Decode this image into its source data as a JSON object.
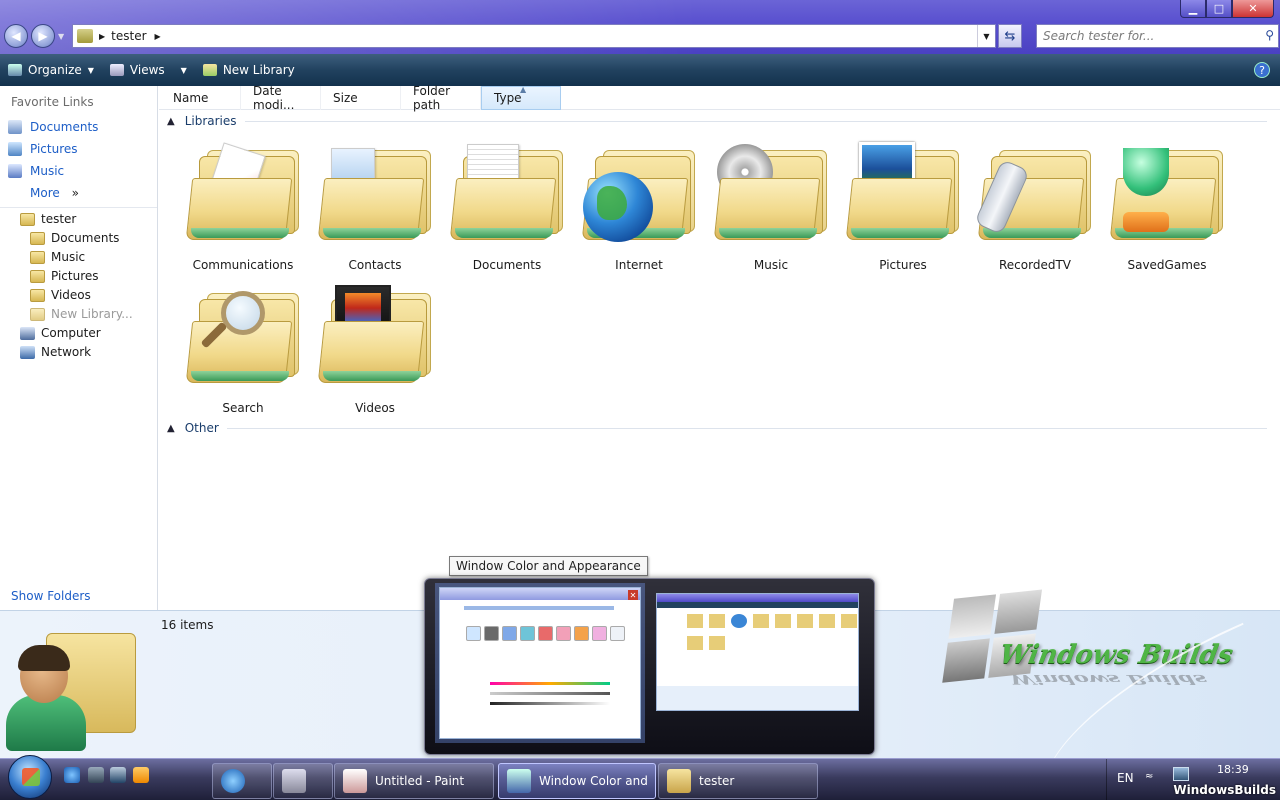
{
  "window": {
    "address": {
      "path_segments": [
        "tester"
      ]
    },
    "search_placeholder": "Search tester for...",
    "buttons": {
      "minimize": "▁",
      "maximize": "□",
      "close": "✕"
    }
  },
  "toolbar": {
    "organize": "Organize",
    "views": "Views",
    "new_library": "New Library",
    "help": "?"
  },
  "navpane": {
    "favorite_links_header": "Favorite Links",
    "favorites": [
      {
        "label": "Documents",
        "icon": "documents-icon"
      },
      {
        "label": "Pictures",
        "icon": "pictures-icon"
      },
      {
        "label": "Music",
        "icon": "music-icon"
      }
    ],
    "more": "More",
    "tree": [
      {
        "label": "tester",
        "icon": "user-folder-icon"
      },
      {
        "label": "Documents",
        "icon": "folder-icon"
      },
      {
        "label": "Music",
        "icon": "folder-icon"
      },
      {
        "label": "Pictures",
        "icon": "folder-icon"
      },
      {
        "label": "Videos",
        "icon": "folder-icon"
      },
      {
        "label": "New Library...",
        "icon": "new-library-icon"
      },
      {
        "label": "Computer",
        "icon": "computer-icon"
      },
      {
        "label": "Network",
        "icon": "network-icon"
      }
    ],
    "show_folders": "Show Folders"
  },
  "columns": [
    "Name",
    "Date modi...",
    "Size",
    "Folder path",
    "Type"
  ],
  "groups": {
    "libraries": "Libraries",
    "other": "Other"
  },
  "libraries": [
    {
      "label": "Communications",
      "icon": "communications-library-icon"
    },
    {
      "label": "Contacts",
      "icon": "contacts-library-icon"
    },
    {
      "label": "Documents",
      "icon": "documents-library-icon"
    },
    {
      "label": "Internet",
      "icon": "internet-library-icon"
    },
    {
      "label": "Music",
      "icon": "music-library-icon"
    },
    {
      "label": "Pictures",
      "icon": "pictures-library-icon"
    },
    {
      "label": "RecordedTV",
      "icon": "recordedtv-library-icon"
    },
    {
      "label": "SavedGames",
      "icon": "savedgames-library-icon"
    },
    {
      "label": "Search",
      "icon": "search-library-icon"
    },
    {
      "label": "Videos",
      "icon": "videos-library-icon"
    }
  ],
  "details": {
    "count": "16 items"
  },
  "thumbnail_popup": {
    "tooltip": "Window Color and Appearance"
  },
  "taskbar": {
    "buttons": [
      {
        "label": "Untitled - Paint",
        "icon": "paint-icon"
      },
      {
        "label": "Window Color and",
        "icon": "control-panel-icon"
      },
      {
        "label": "tester",
        "icon": "user-folder-icon"
      }
    ],
    "tray": {
      "language": "EN",
      "time": "18:39"
    }
  },
  "watermark": "WindowsBuilds",
  "brand_logo_text": "Windows Builds"
}
